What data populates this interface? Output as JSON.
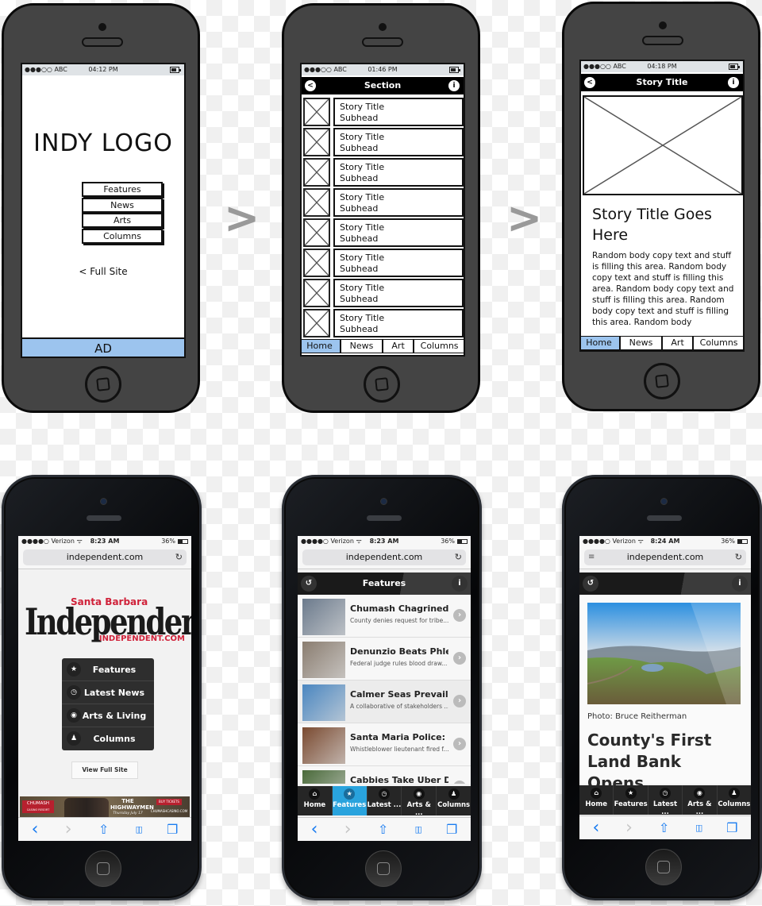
{
  "flow_arrows": [
    ">",
    ">"
  ],
  "wireframes": {
    "home": {
      "status": {
        "carrier": "●●●○○ ABC",
        "time": "04:12 PM"
      },
      "logo": "INDY LOGO",
      "menu": [
        "Features",
        "News",
        "Arts",
        "Columns"
      ],
      "full_site_link": "< Full Site",
      "ad": "AD",
      "ad_color": "#9cc4ee"
    },
    "section": {
      "status": {
        "carrier": "●●●○○ ABC",
        "time": "01:46 PM"
      },
      "nav_title": "Section",
      "back_icon": "<",
      "info_icon": "i",
      "rows": [
        {
          "title": "Story Title",
          "subhead": "Subhead"
        },
        {
          "title": "Story Title",
          "subhead": "Subhead"
        },
        {
          "title": "Story Title",
          "subhead": "Subhead"
        },
        {
          "title": "Story Title",
          "subhead": "Subhead"
        },
        {
          "title": "Story Title",
          "subhead": "Subhead"
        },
        {
          "title": "Story Title",
          "subhead": "Subhead"
        },
        {
          "title": "Story Title",
          "subhead": "Subhead"
        },
        {
          "title": "Story Title",
          "subhead": "Subhead"
        }
      ],
      "tabs": [
        "Home",
        "News",
        "Art",
        "Columns"
      ],
      "active_tab": "Home"
    },
    "story": {
      "status": {
        "carrier": "●●●○○ ABC",
        "time": "04:18 PM"
      },
      "nav_title": "Story Title",
      "back_icon": "<",
      "info_icon": "i",
      "headline": "Story Title Goes Here",
      "body": "Random body copy text and stuff is filling this area. Random body copy text and stuff is filling this area. Random body copy text and stuff is filling this area. Random body copy text and stuff is filling this area. Random body",
      "tabs": [
        "Home",
        "News",
        "Art",
        "Columns"
      ],
      "active_tab": "Home"
    }
  },
  "live": {
    "status": {
      "carrier": "●●●●○ Verizon ᯤ",
      "battery": "36%"
    },
    "url": "independent.com",
    "home": {
      "time": "8:23 AM",
      "logo": {
        "top": "Santa Barbara",
        "main": "Independent",
        "bottom": "INDEPENDENT.COM"
      },
      "menu": [
        {
          "icon": "star-icon",
          "glyph": "★",
          "label": "Features"
        },
        {
          "icon": "clock-icon",
          "glyph": "◷",
          "label": "Latest News"
        },
        {
          "icon": "eye-icon",
          "glyph": "◉",
          "label": "Arts & Living"
        },
        {
          "icon": "user-icon",
          "glyph": "♟",
          "label": "Columns"
        }
      ],
      "full_site_button": "View Full Site",
      "ad": {
        "left": "CHUMASH",
        "left_sub": "CASINO RESORT",
        "title": "THE HIGHWAYMEN",
        "date": "Thursday July 17",
        "cta": "BUY TICKETS",
        "site": "CHUMASHCASINO.COM"
      }
    },
    "features": {
      "time": "8:23 AM",
      "nav_title": "Features",
      "back_icon": "↺",
      "info_icon": "i",
      "stories": [
        {
          "title": "Chumash Chagrined ...",
          "sub": "County denies request for tribe...",
          "thumb": "#6b7a8c"
        },
        {
          "title": "Denunzio Beats Phle...",
          "sub": "Federal judge rules blood draw...",
          "thumb": "#8a7d70"
        },
        {
          "title": "Calmer Seas Prevail i...",
          "sub": "A collaborative of stakeholders ...",
          "thumb": "#4a86c0"
        },
        {
          "title": "Santa Maria Police: I...",
          "sub": "Whistleblower lieutenant fired f...",
          "thumb": "#7a4a30"
        },
        {
          "title": "Cabbies Take Uber D...",
          "sub": "",
          "thumb": "#4a6a3a"
        }
      ],
      "active_tab": "Features"
    },
    "article": {
      "time": "8:24 AM",
      "back_icon": "↺",
      "info_icon": "i",
      "photo_credit": "Photo: Bruce Reitherman",
      "headline": "County's First Land Bank Opens",
      "active_tab": ""
    },
    "tabs": [
      {
        "icon": "home-icon",
        "glyph": "⌂",
        "label": "Home"
      },
      {
        "icon": "star-icon",
        "glyph": "★",
        "label": "Features"
      },
      {
        "icon": "clock-icon",
        "glyph": "◷",
        "label": "Latest ..."
      },
      {
        "icon": "eye-icon",
        "glyph": "◉",
        "label": "Arts & ..."
      },
      {
        "icon": "user-icon",
        "glyph": "♟",
        "label": "Columns"
      }
    ],
    "toolbar": [
      {
        "icon": "back-icon",
        "glyph": "‹"
      },
      {
        "icon": "forward-icon",
        "glyph": "›"
      },
      {
        "icon": "share-icon",
        "glyph": "⇧"
      },
      {
        "icon": "bookmarks-icon",
        "glyph": "▯▯"
      },
      {
        "icon": "tabs-icon",
        "glyph": "❐"
      }
    ],
    "accent_color": "#29a3dd",
    "logo_red": "#d0223a"
  }
}
